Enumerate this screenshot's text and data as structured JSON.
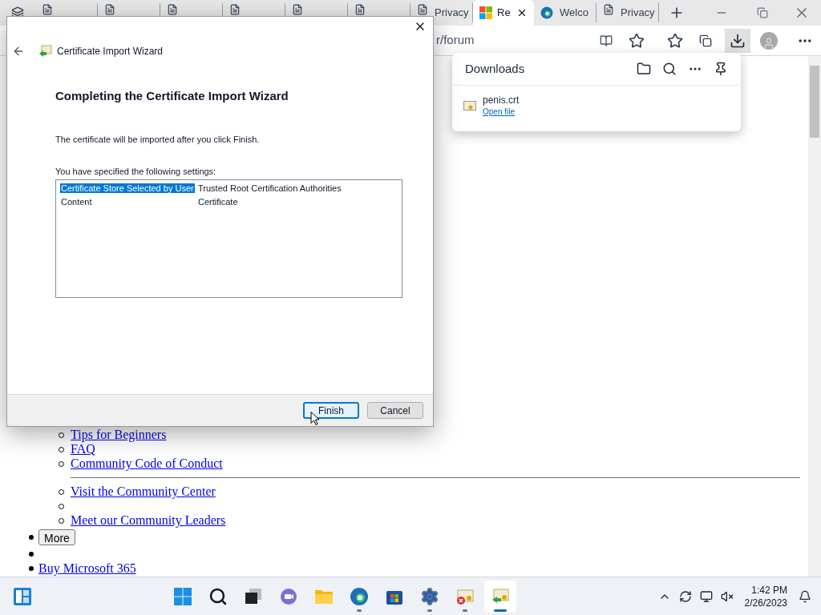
{
  "browser": {
    "tabs": [
      {
        "kind": "page",
        "selected": false
      },
      {
        "kind": "page",
        "selected": false
      },
      {
        "kind": "page",
        "selected": false
      },
      {
        "kind": "page",
        "selected": false
      },
      {
        "kind": "page",
        "selected": false
      },
      {
        "kind": "page",
        "selected": false
      },
      {
        "kind": "page",
        "label": "Privacy",
        "selected": false
      },
      {
        "kind": "windows",
        "label": "Re",
        "selected": true
      },
      {
        "kind": "edge",
        "label": "Welco",
        "selected": false
      },
      {
        "kind": "page",
        "label": "Privacy",
        "selected": false
      }
    ],
    "address": "r/forum",
    "downloads_active": true
  },
  "downloads": {
    "title": "Downloads",
    "items": [
      {
        "name": "penis.crt",
        "action": "Open file"
      }
    ]
  },
  "page": {
    "items": [
      {
        "kind": "sublink",
        "text": "Tips for Beginners"
      },
      {
        "kind": "sublink",
        "text": "FAQ"
      },
      {
        "kind": "sublink",
        "text": "Community Code of Conduct"
      },
      {
        "kind": "rule"
      },
      {
        "kind": "sublink",
        "text": "Visit the Community Center"
      },
      {
        "kind": "subempty"
      },
      {
        "kind": "sublink",
        "text": "Meet our Community Leaders"
      },
      {
        "kind": "button",
        "text": "More"
      },
      {
        "kind": "empty"
      },
      {
        "kind": "link",
        "text": "Buy Microsoft 365"
      }
    ]
  },
  "dialog": {
    "title": "Certificate Import Wizard",
    "heading": "Completing the Certificate Import Wizard",
    "message": "The certificate will be imported after you click Finish.",
    "settings_label": "You have specified the following settings:",
    "settings": [
      {
        "name": "Certificate Store Selected by User",
        "value": "Trusted Root Certification Authorities",
        "selected": true
      },
      {
        "name": "Content",
        "value": "Certificate",
        "selected": false
      }
    ],
    "buttons": [
      {
        "label": "Finish",
        "default": true
      },
      {
        "label": "Cancel",
        "default": false
      }
    ]
  },
  "taskbar": {
    "apps": [
      {
        "kind": "start",
        "running": false,
        "selected": false
      },
      {
        "kind": "search",
        "running": false,
        "selected": false
      },
      {
        "kind": "taskview",
        "running": false,
        "selected": false
      },
      {
        "kind": "chat",
        "running": false,
        "selected": false
      },
      {
        "kind": "folder",
        "running": false,
        "selected": false
      },
      {
        "kind": "edge",
        "running": true,
        "selected": false
      },
      {
        "kind": "store",
        "running": false,
        "selected": false
      },
      {
        "kind": "settings",
        "running": true,
        "selected": false
      },
      {
        "kind": "cert-error",
        "running": true,
        "selected": false
      },
      {
        "kind": "cert-import",
        "running": true,
        "selected": true
      }
    ],
    "time": "1:42 PM",
    "date": "2/26/2023"
  }
}
